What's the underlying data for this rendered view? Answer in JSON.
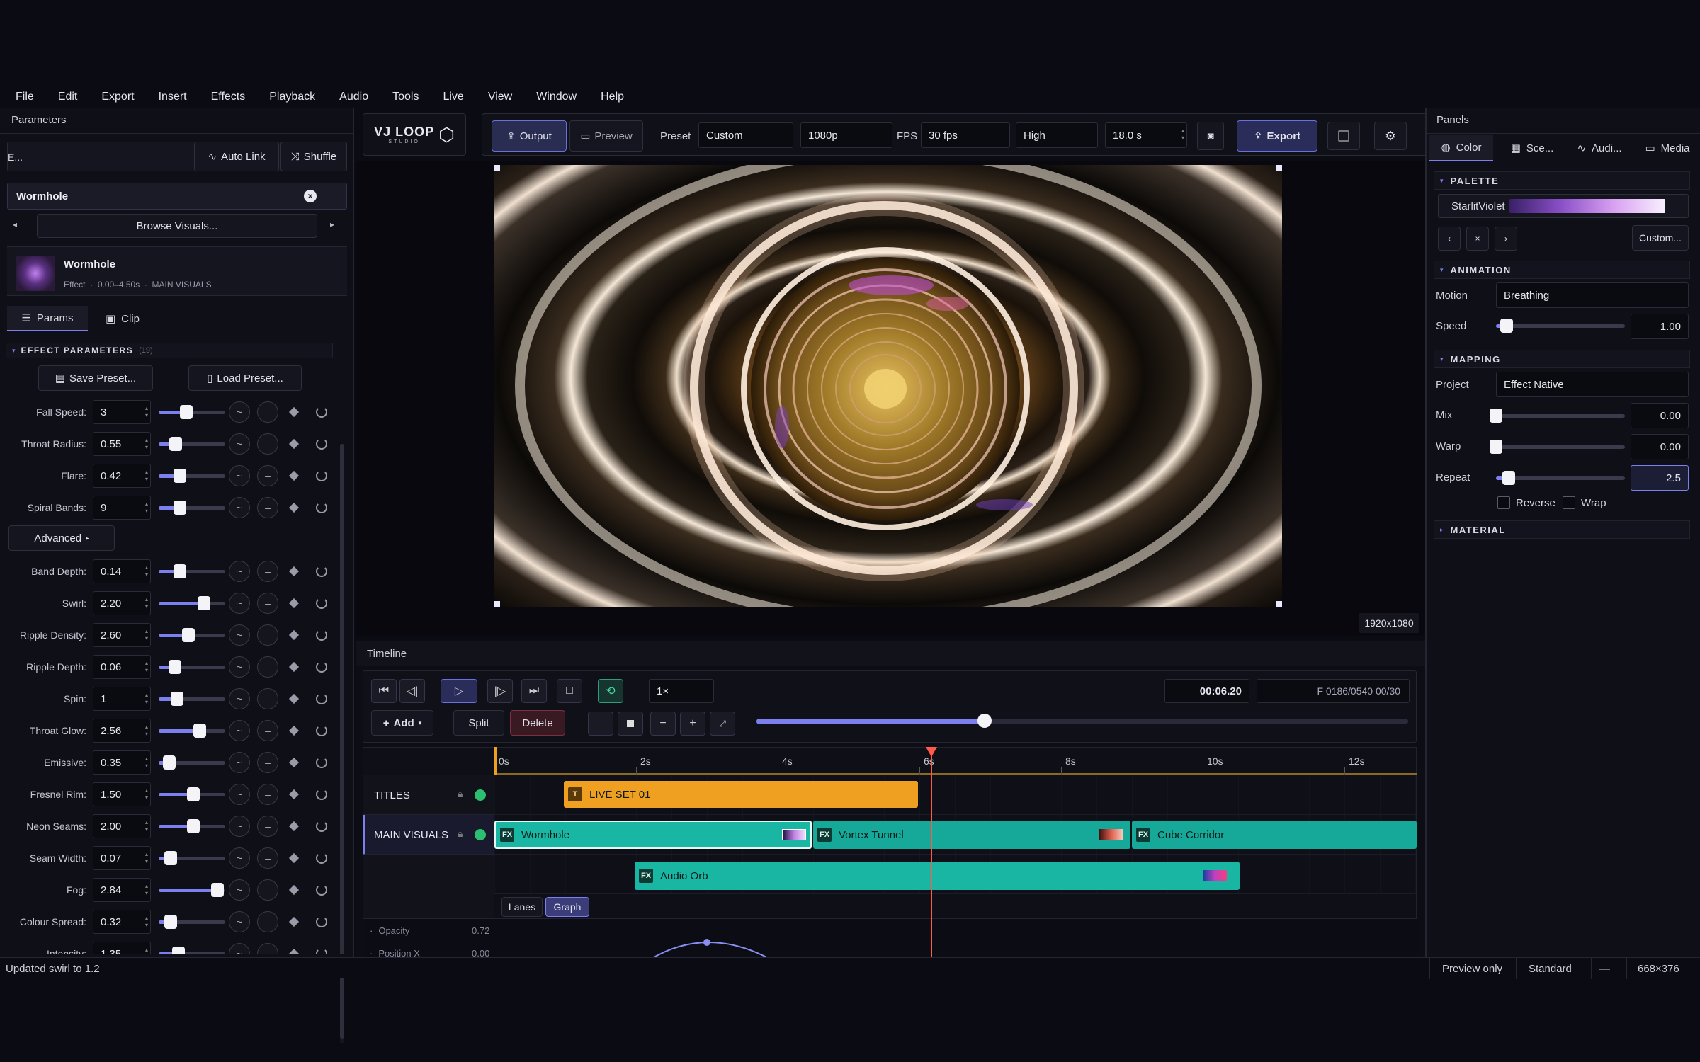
{
  "menu": [
    "File",
    "Edit",
    "Export",
    "Insert",
    "Effects",
    "Playback",
    "Audio",
    "Tools",
    "Live",
    "View",
    "Window",
    "Help"
  ],
  "left_panel": {
    "title": "Parameters",
    "link_label": "E...",
    "auto_link": "Auto Link",
    "shuffle": "Shuffle",
    "effect_name": "Wormhole",
    "browse": "Browse Visuals...",
    "card": {
      "name": "Wormhole",
      "type": "Effect",
      "range": "0.00–4.50s",
      "track": "MAIN VISUALS"
    },
    "tabs": [
      "Params",
      "Clip"
    ],
    "section": "EFFECT PARAMETERS",
    "section_count": "(19)",
    "save_preset": "Save Preset...",
    "load_preset": "Load Preset...",
    "advanced": "Advanced",
    "params_top": [
      {
        "label": "Fall Speed:",
        "value": "3",
        "level": 0.42
      },
      {
        "label": "Throat Radius:",
        "value": "0.55",
        "level": 0.26
      },
      {
        "label": "Flare:",
        "value": "0.42",
        "level": 0.32
      },
      {
        "label": "Spiral Bands:",
        "value": "9",
        "level": 0.32
      }
    ],
    "params_adv": [
      {
        "label": "Band Depth:",
        "value": "0.14",
        "level": 0.32
      },
      {
        "label": "Swirl:",
        "value": "2.20",
        "level": 0.68
      },
      {
        "label": "Ripple Density:",
        "value": "2.60",
        "level": 0.45
      },
      {
        "label": "Ripple Depth:",
        "value": "0.06",
        "level": 0.24
      },
      {
        "label": "Spin:",
        "value": "1",
        "level": 0.28
      },
      {
        "label": "Throat Glow:",
        "value": "2.56",
        "level": 0.62
      },
      {
        "label": "Emissive:",
        "value": "0.35",
        "level": 0.16
      },
      {
        "label": "Fresnel Rim:",
        "value": "1.50",
        "level": 0.52
      },
      {
        "label": "Neon Seams:",
        "value": "2.00",
        "level": 0.52
      },
      {
        "label": "Seam Width:",
        "value": "0.07",
        "level": 0.18
      },
      {
        "label": "Fog:",
        "value": "2.84",
        "level": 0.88
      },
      {
        "label": "Colour Spread:",
        "value": "0.32",
        "level": 0.18
      },
      {
        "label": "Intensity:",
        "value": "1.35",
        "level": 0.3
      }
    ]
  },
  "toolbar": {
    "logo": "VJ LOOP",
    "logo_sub": "STUDIO",
    "output": "Output",
    "preview": "Preview",
    "preset_label": "Preset",
    "preset": "Custom",
    "resolution": "1080p",
    "fps_label": "FPS",
    "fps": "30 fps",
    "quality": "High",
    "duration": "18.0 s",
    "export": "Export"
  },
  "viewer": {
    "resolution": "1920x1080"
  },
  "timeline": {
    "title": "Timeline",
    "speed": "1×",
    "timecode": "00:06.20",
    "frame": "F 0186/0540  00/30",
    "scrub": 0.35,
    "add": "Add",
    "split": "Split",
    "delete": "Delete",
    "ruler": [
      "0s",
      "2s",
      "4s",
      "6s",
      "8s",
      "10s",
      "12s"
    ],
    "tracks": [
      {
        "name": "TITLES"
      },
      {
        "name": "MAIN VISUALS"
      }
    ],
    "clips": {
      "title": "LIVE SET 01",
      "wormhole": "Wormhole",
      "vortex": "Vortex Tunnel",
      "cube": "Cube Corridor",
      "orb": "Audio Orb"
    },
    "view_tabs": [
      "Lanes",
      "Graph"
    ],
    "graph": [
      {
        "name": "Opacity",
        "value": "0.72"
      },
      {
        "name": "Position X",
        "value": "0.00"
      }
    ]
  },
  "right_panel": {
    "title": "Panels",
    "tabs": [
      "Color",
      "Sce...",
      "Audi...",
      "Media"
    ],
    "palette_section": "PALETTE",
    "palette_name": "StarlitViolet",
    "custom": "Custom...",
    "animation_section": "ANIMATION",
    "motion_label": "Motion",
    "motion": "Breathing",
    "speed_label": "Speed",
    "speed": "1.00",
    "speed_level": 0.08,
    "mapping_section": "MAPPING",
    "project_label": "Project",
    "project": "Effect Native",
    "mix_label": "Mix",
    "mix": "0.00",
    "mix_level": 0.0,
    "warp_label": "Warp",
    "warp": "0.00",
    "warp_level": 0.0,
    "repeat_label": "Repeat",
    "repeat": "2.5",
    "repeat_level": 0.1,
    "reverse": "Reverse",
    "wrap": "Wrap",
    "material_section": "MATERIAL"
  },
  "status": {
    "message": "Updated swirl to 1.2",
    "mode": "Preview only",
    "quality": "Standard",
    "dash": "—",
    "size": "668×376"
  },
  "colors": {
    "accent": "#7b80ee",
    "teal": "#1ab6a4",
    "orange": "#f0a020",
    "playhead": "#ff5a4a"
  }
}
